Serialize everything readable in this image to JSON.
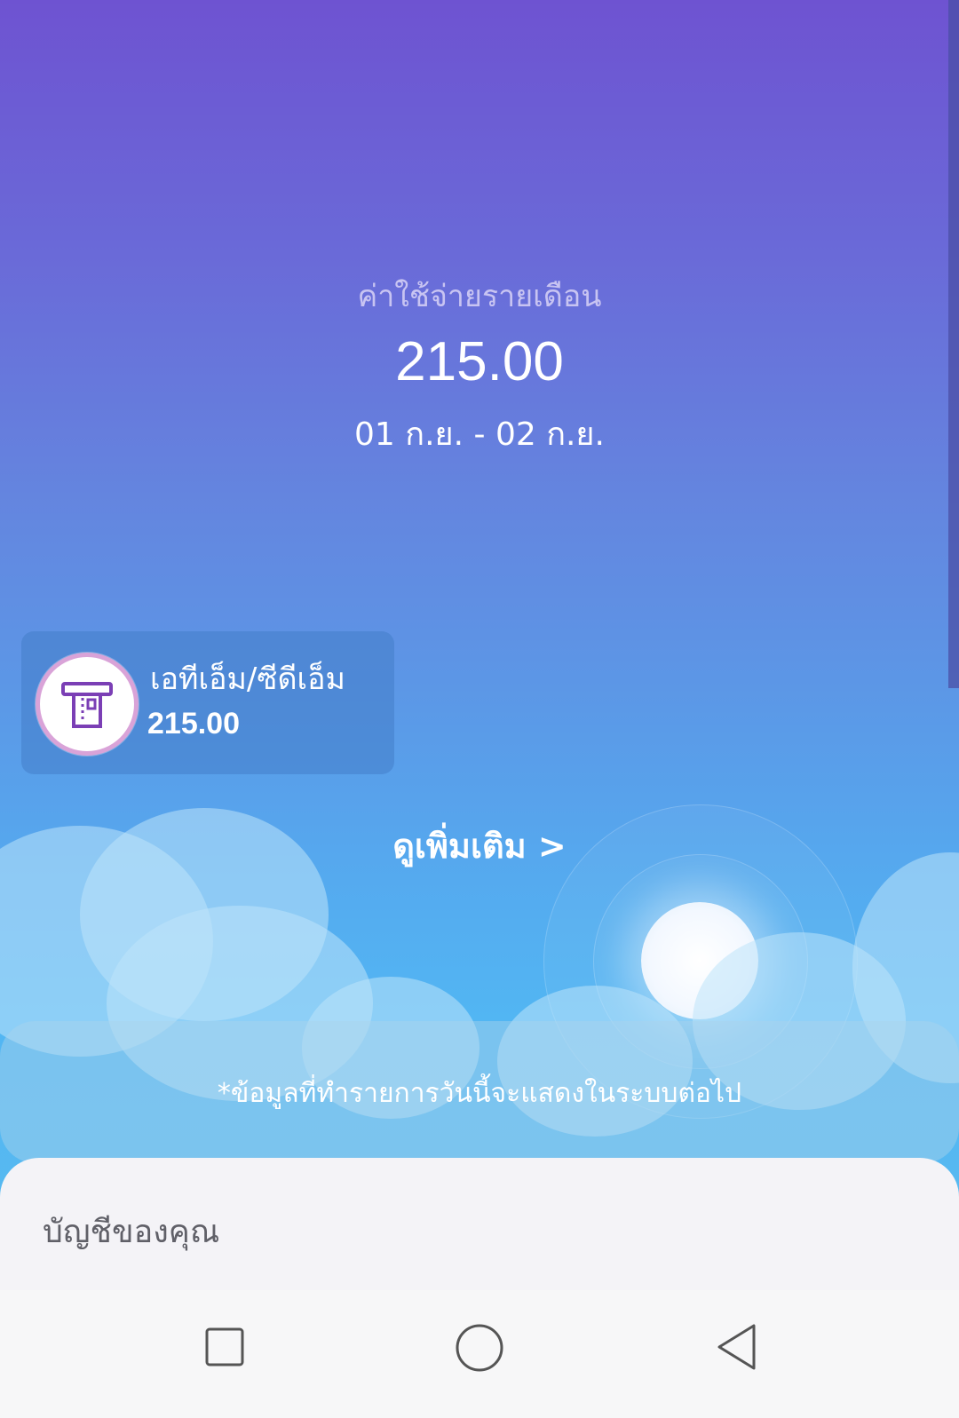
{
  "summary": {
    "title": "ค่าใช้จ่ายรายเดือน",
    "amount": "215.00",
    "date_range": "01 ก.ย. - 02 ก.ย."
  },
  "category_card": {
    "icon": "atm-icon",
    "name": "เอทีเอ็ม/ซีดีเอ็ม",
    "amount": "215.00"
  },
  "see_more_label": "ดูเพิ่มเติม >",
  "note": "*ข้อมูลที่ทำรายการวันนี้จะแสดงในระบบต่อไป",
  "accounts_section": {
    "title": "บัญชีของคุณ"
  },
  "navbar": {
    "recent_icon": "square-icon",
    "home_icon": "circle-icon",
    "back_icon": "triangle-back-icon"
  },
  "colors": {
    "gradient_top": "#6e53d1",
    "gradient_bottom": "#52b6f3",
    "icon_ring": "#d9a3d8",
    "icon_stroke": "#7b3fb5"
  }
}
